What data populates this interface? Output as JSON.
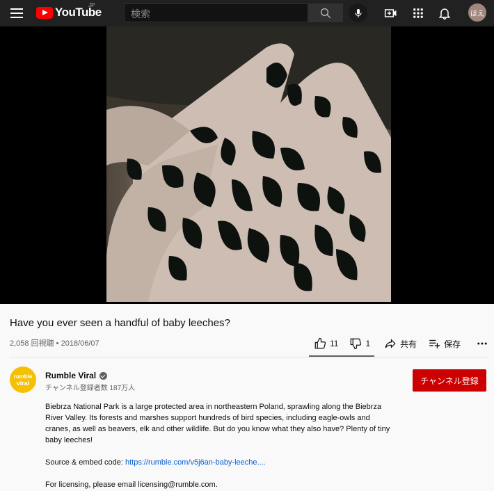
{
  "masthead": {
    "logo_text": "YouTube",
    "region": "JP",
    "search_placeholder": "検索",
    "avatar_text": "ほえ"
  },
  "video": {
    "title": "Have you ever seen a handful of baby leeches?",
    "views": "2,058 回視聴",
    "date": "2018/06/07"
  },
  "actions": {
    "like_count": "11",
    "dislike_count": "1",
    "share_label": "共有",
    "save_label": "保存"
  },
  "channel": {
    "name": "Rumble Viral",
    "subscribers": "チャンネル登録者数 187万人",
    "avatar_line1": "rumble",
    "avatar_line2": "viral",
    "subscribe_label": "チャンネル登録"
  },
  "description": {
    "paragraph": "Biebrza National Park is a large protected area in northeastern Poland, sprawling along the Biebrza River Valley. Its forests and marshes support hundreds of bird species, including eagle-owls and cranes, as well as beavers, elk and other wildlife. But do you know what they also have? Plenty of tiny baby leeches!",
    "source_prefix": "Source & embed code: ",
    "source_link": "https://rumble.com/v5j6an-baby-leeche....",
    "licensing": "For licensing, please email licensing@rumble.com."
  },
  "colors": {
    "masthead_bg": "#212121",
    "logo_red": "#ff0000",
    "subscribe_red": "#cc0000",
    "link_blue": "#065fd4",
    "channel_avatar": "#f5c000"
  },
  "icons": [
    "menu-icon",
    "search-icon",
    "mic-icon",
    "create-video-icon",
    "apps-icon",
    "bell-icon",
    "thumbs-up-icon",
    "thumbs-down-icon",
    "share-icon",
    "save-playlist-icon",
    "more-icon",
    "verified-icon"
  ]
}
